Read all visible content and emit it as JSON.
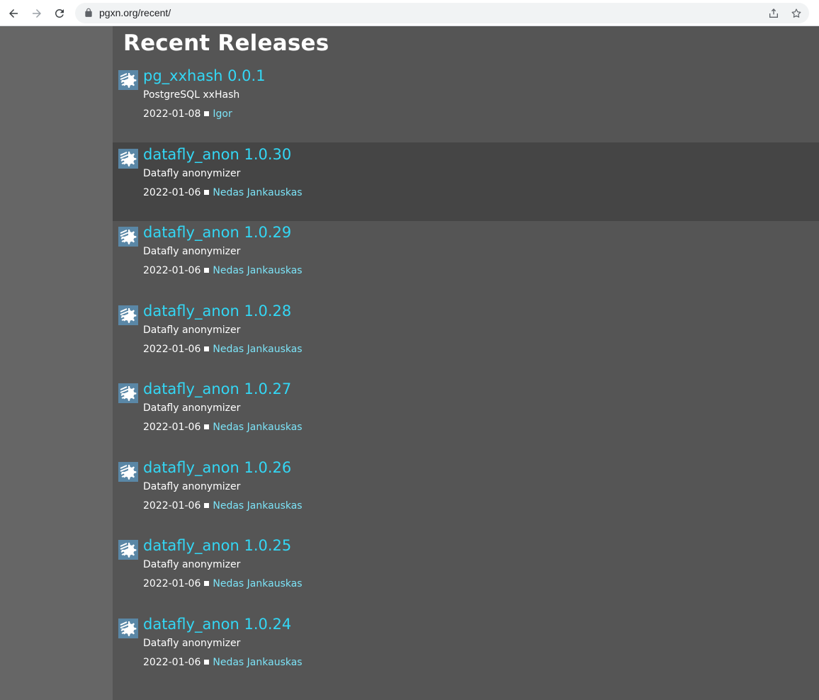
{
  "browser": {
    "url": "pgxn.org/recent/"
  },
  "page": {
    "title": "Recent Releases"
  },
  "releases": [
    {
      "name": "pg_xxhash 0.0.1",
      "abstract": "PostgreSQL xxHash",
      "date": "2022-01-08",
      "author": "Igor"
    },
    {
      "name": "datafly_anon 1.0.30",
      "abstract": "Datafly anonymizer",
      "date": "2022-01-06",
      "author": "Nedas Jankauskas"
    },
    {
      "name": "datafly_anon 1.0.29",
      "abstract": "Datafly anonymizer",
      "date": "2022-01-06",
      "author": "Nedas Jankauskas"
    },
    {
      "name": "datafly_anon 1.0.28",
      "abstract": "Datafly anonymizer",
      "date": "2022-01-06",
      "author": "Nedas Jankauskas"
    },
    {
      "name": "datafly_anon 1.0.27",
      "abstract": "Datafly anonymizer",
      "date": "2022-01-06",
      "author": "Nedas Jankauskas"
    },
    {
      "name": "datafly_anon 1.0.26",
      "abstract": "Datafly anonymizer",
      "date": "2022-01-06",
      "author": "Nedas Jankauskas"
    },
    {
      "name": "datafly_anon 1.0.25",
      "abstract": "Datafly anonymizer",
      "date": "2022-01-06",
      "author": "Nedas Jankauskas"
    },
    {
      "name": "datafly_anon 1.0.24",
      "abstract": "Datafly anonymizer",
      "date": "2022-01-06",
      "author": "Nedas Jankauskas"
    }
  ],
  "icons": {
    "back": "arrow-left-icon",
    "forward": "arrow-right-icon",
    "reload": "reload-icon",
    "lock": "lock-icon",
    "share": "share-icon",
    "bookmark": "star-icon",
    "release": "distribution-gear-icon"
  },
  "colors": {
    "background": "#555555",
    "gutter": "#666666",
    "highlight_row": "#454545",
    "link": "#33d7f5",
    "author_link": "#7ce3f7",
    "text": "#ffffff"
  }
}
